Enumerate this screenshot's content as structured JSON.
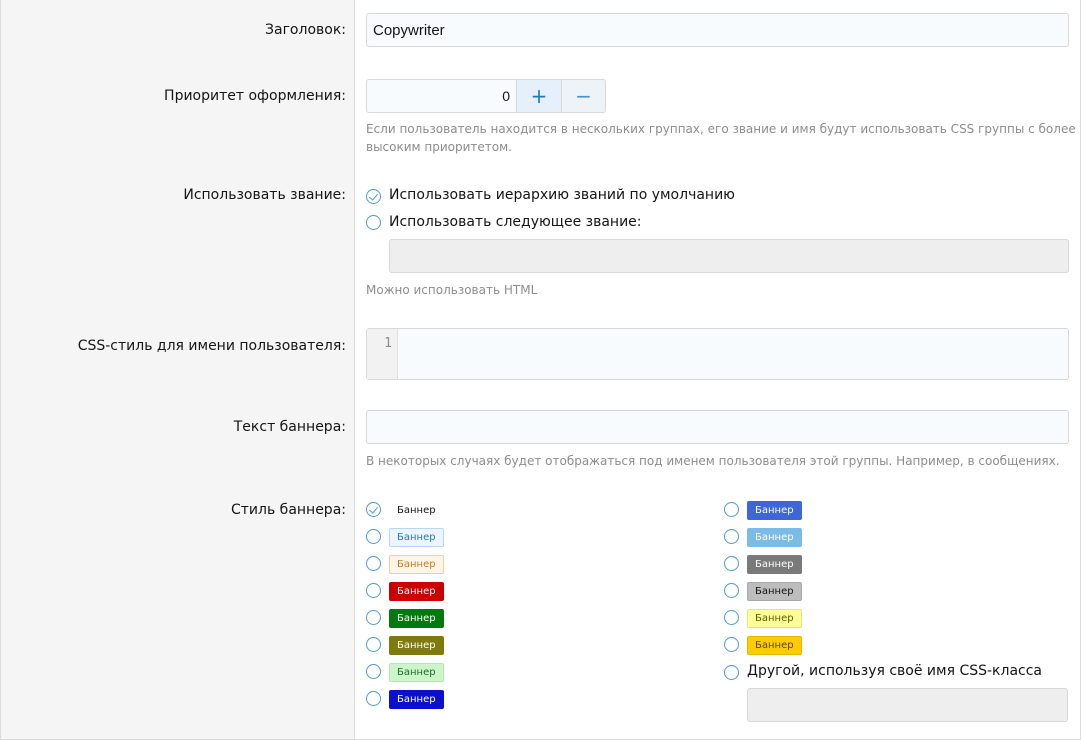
{
  "title_field": {
    "label": "Заголовок:",
    "value": "Copywriter"
  },
  "priority": {
    "label": "Приоритет оформления:",
    "value": "0",
    "plus": "+",
    "minus": "−",
    "hint_line1": "Если пользователь находится в нескольких группах, его звание и имя будут использовать CSS группы с более",
    "hint_line2": "высоким приоритетом."
  },
  "rank": {
    "label": "Использовать звание:",
    "option_default": "Использовать иерархию званий по умолчанию",
    "option_custom": "Использовать следующее звание:",
    "selected": "default",
    "custom_value": "",
    "hint": "Можно использовать HTML"
  },
  "username_css": {
    "label": "CSS-стиль для имени пользователя:",
    "line_number": "1",
    "value": ""
  },
  "banner_text": {
    "label": "Текст баннера:",
    "value": "",
    "hint": "В некоторых случаях будет отображаться под именем пользователя этой группы. Например, в сообщениях."
  },
  "banner_style": {
    "label": "Стиль баннера:",
    "selected": 0,
    "left": [
      {
        "text": "Баннер",
        "bg": "#ffffff",
        "fg": "#141414",
        "border": "#ffffff"
      },
      {
        "text": "Баннер",
        "bg": "#ecf5fd",
        "fg": "#2577b1",
        "border": "#b9d7f0"
      },
      {
        "text": "Баннер",
        "bg": "#fdf5e8",
        "fg": "#c57b1d",
        "border": "#f2cf97"
      },
      {
        "text": "Баннер",
        "bg": "#cc0000",
        "fg": "#ffffff",
        "border": "#cc0000"
      },
      {
        "text": "Баннер",
        "bg": "#007a0f",
        "fg": "#ffffff",
        "border": "#007a0f"
      },
      {
        "text": "Баннер",
        "bg": "#7f7a0e",
        "fg": "#ffffff",
        "border": "#7f7a0e"
      },
      {
        "text": "Баннер",
        "bg": "#ccf5cc",
        "fg": "#1f6b1f",
        "border": "#b4e6b4"
      },
      {
        "text": "Баннер",
        "bg": "#0a10cc",
        "fg": "#ffffff",
        "border": "#0a10cc"
      }
    ],
    "right": [
      {
        "text": "Баннер",
        "bg": "#3d66d6",
        "fg": "#ffffff",
        "border": "#3d66d6"
      },
      {
        "text": "Баннер",
        "bg": "#7cbbe6",
        "fg": "#ffffff",
        "border": "#7cbbe6"
      },
      {
        "text": "Баннер",
        "bg": "#7a7a7a",
        "fg": "#ffffff",
        "border": "#7a7a7a"
      },
      {
        "text": "Баннер",
        "bg": "#bdbdbd",
        "fg": "#141414",
        "border": "#a8a8a8"
      },
      {
        "text": "Баннер",
        "bg": "#ffff99",
        "fg": "#5a5a00",
        "border": "#e6e67a"
      },
      {
        "text": "Баннер",
        "bg": "#ffcc00",
        "fg": "#5a4000",
        "border": "#e6b800"
      }
    ],
    "other_label": "Другой, используя своё имя CSS-класса",
    "other_value": ""
  }
}
